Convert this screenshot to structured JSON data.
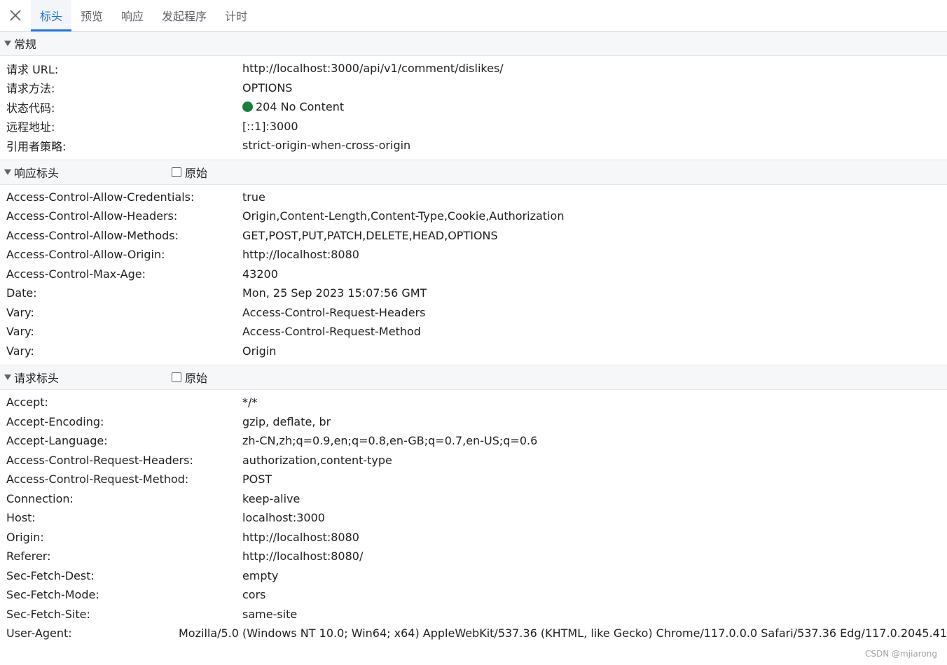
{
  "tabs": [
    {
      "label": "标头",
      "active": true
    },
    {
      "label": "预览",
      "active": false
    },
    {
      "label": "响应",
      "active": false
    },
    {
      "label": "发起程序",
      "active": false
    },
    {
      "label": "计时",
      "active": false
    }
  ],
  "general": {
    "title": "常规",
    "rows": [
      {
        "key": "请求 URL:",
        "value": "http://localhost:3000/api/v1/comment/dislikes/"
      },
      {
        "key": "请求方法:",
        "value": "OPTIONS"
      },
      {
        "key": "状态代码:",
        "value": "204 No Content"
      },
      {
        "key": "远程地址:",
        "value": "[::1]:3000"
      },
      {
        "key": "引用者策略:",
        "value": "strict-origin-when-cross-origin"
      }
    ],
    "status_color": "#188038"
  },
  "response_headers": {
    "title": "响应标头",
    "raw_label": "原始",
    "rows": [
      {
        "key": "Access-Control-Allow-Credentials:",
        "value": "true"
      },
      {
        "key": "Access-Control-Allow-Headers:",
        "value": "Origin,Content-Length,Content-Type,Cookie,Authorization"
      },
      {
        "key": "Access-Control-Allow-Methods:",
        "value": "GET,POST,PUT,PATCH,DELETE,HEAD,OPTIONS"
      },
      {
        "key": "Access-Control-Allow-Origin:",
        "value": "http://localhost:8080"
      },
      {
        "key": "Access-Control-Max-Age:",
        "value": "43200"
      },
      {
        "key": "Date:",
        "value": "Mon, 25 Sep 2023 15:07:56 GMT"
      },
      {
        "key": "Vary:",
        "value": "Access-Control-Request-Headers"
      },
      {
        "key": "Vary:",
        "value": "Access-Control-Request-Method"
      },
      {
        "key": "Vary:",
        "value": "Origin"
      }
    ]
  },
  "request_headers": {
    "title": "请求标头",
    "raw_label": "原始",
    "rows": [
      {
        "key": "Accept:",
        "value": "*/*"
      },
      {
        "key": "Accept-Encoding:",
        "value": "gzip, deflate, br"
      },
      {
        "key": "Accept-Language:",
        "value": "zh-CN,zh;q=0.9,en;q=0.8,en-GB;q=0.7,en-US;q=0.6"
      },
      {
        "key": "Access-Control-Request-Headers:",
        "value": "authorization,content-type"
      },
      {
        "key": "Access-Control-Request-Method:",
        "value": "POST"
      },
      {
        "key": "Connection:",
        "value": "keep-alive"
      },
      {
        "key": "Host:",
        "value": "localhost:3000"
      },
      {
        "key": "Origin:",
        "value": "http://localhost:8080"
      },
      {
        "key": "Referer:",
        "value": "http://localhost:8080/"
      },
      {
        "key": "Sec-Fetch-Dest:",
        "value": "empty"
      },
      {
        "key": "Sec-Fetch-Mode:",
        "value": "cors"
      },
      {
        "key": "Sec-Fetch-Site:",
        "value": "same-site"
      },
      {
        "key": "User-Agent:",
        "value": "Mozilla/5.0 (Windows NT 10.0; Win64; x64) AppleWebKit/537.36 (KHTML, like Gecko) Chrome/117.0.0.0 Safari/537.36 Edg/117.0.2045.41"
      }
    ]
  },
  "watermark": "CSDN @mjiarong"
}
